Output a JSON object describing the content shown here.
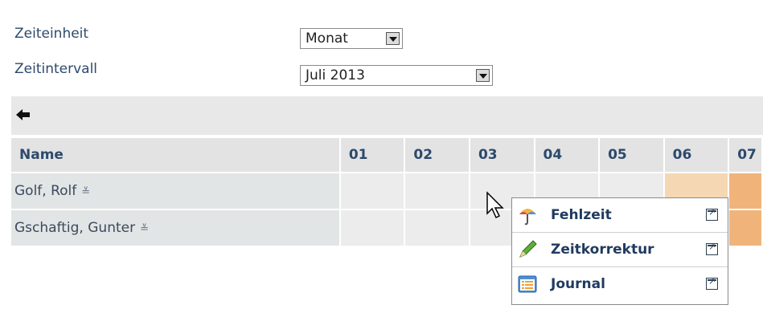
{
  "form": {
    "zeiteinheit_label": "Zeiteinheit",
    "zeiteinheit_value": "Monat",
    "zeitintervall_label": "Zeitintervall",
    "zeitintervall_value": "Juli 2013"
  },
  "icons": {
    "back": "arrow-left-icon",
    "expand": "chevron-double-down-icon",
    "popup_open": "open-external-icon",
    "cursor": "mouse-pointer-icon"
  },
  "table": {
    "headers": [
      "Name",
      "01",
      "02",
      "03",
      "04",
      "05",
      "06",
      "07"
    ],
    "rows": [
      {
        "name": "Golf, Rolf"
      },
      {
        "name": "Gschaftig, Gunter"
      }
    ]
  },
  "context_menu": {
    "items": [
      {
        "label": "Fehlzeit",
        "icon": "umbrella-icon"
      },
      {
        "label": "Zeitkorrektur",
        "icon": "pencil-icon"
      },
      {
        "label": "Journal",
        "icon": "journal-icon"
      }
    ]
  },
  "colors": {
    "weekend_light": "#f5d7b3",
    "weekend_dark": "#f0b47a",
    "header_bg": "#e3e3e3",
    "label": "#2c4a6b"
  }
}
